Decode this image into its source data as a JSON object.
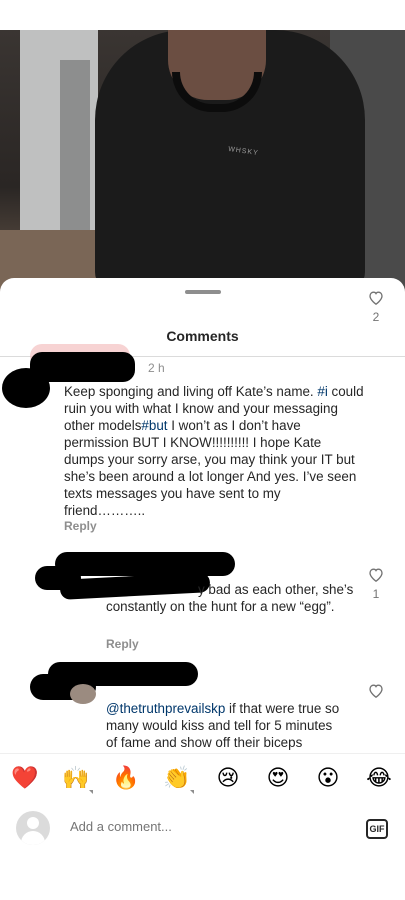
{
  "post": {
    "image_label": "WHSKY"
  },
  "comments_sheet": {
    "title": "Comments",
    "comments": [
      {
        "time": "2 h",
        "text_parts": [
          "Keep sponging and living off Kate’s name. ",
          "#i",
          " could ruin you with what I know and your messaging other models",
          "#but",
          " I won’t as I don’t have permission  BUT I KNOW!!!!!!!!!! I hope Kate dumps your sorry arse, you may think your IT  but she’s been around a lot longer  And yes. I’ve seen texts messages you have sent to my friend……….."
        ],
        "reply": "Reply",
        "likes": "2"
      },
      {
        "text": "y bad as each other, she’s constantly on the hunt for a new “egg”.",
        "reply": "Reply",
        "likes": "1"
      },
      {
        "mention": "@thetruthprevailskp",
        "text": "  if that were true  so many would kiss and tell for 5 minutes of fame and show off their biceps",
        "reply": "Reply",
        "likes": ""
      }
    ]
  },
  "emoji_bar": {
    "emojis": [
      {
        "name": "red-heart",
        "glyph": "❤️"
      },
      {
        "name": "raising-hands",
        "glyph": "🙌"
      },
      {
        "name": "fire",
        "glyph": "🔥"
      },
      {
        "name": "clapping-hands",
        "glyph": "👏"
      },
      {
        "name": "crying-face",
        "glyph": "😢"
      },
      {
        "name": "heart-eyes",
        "glyph": "😍"
      },
      {
        "name": "surprised-face",
        "glyph": "😮"
      },
      {
        "name": "tears-of-joy",
        "glyph": "😂"
      }
    ]
  },
  "composer": {
    "placeholder": "Add a comment...",
    "gif_label": "GIF"
  },
  "colors": {
    "text": "#262626",
    "secondary": "#8e8e8e",
    "mention": "#00376b",
    "redaction": "#000000"
  }
}
